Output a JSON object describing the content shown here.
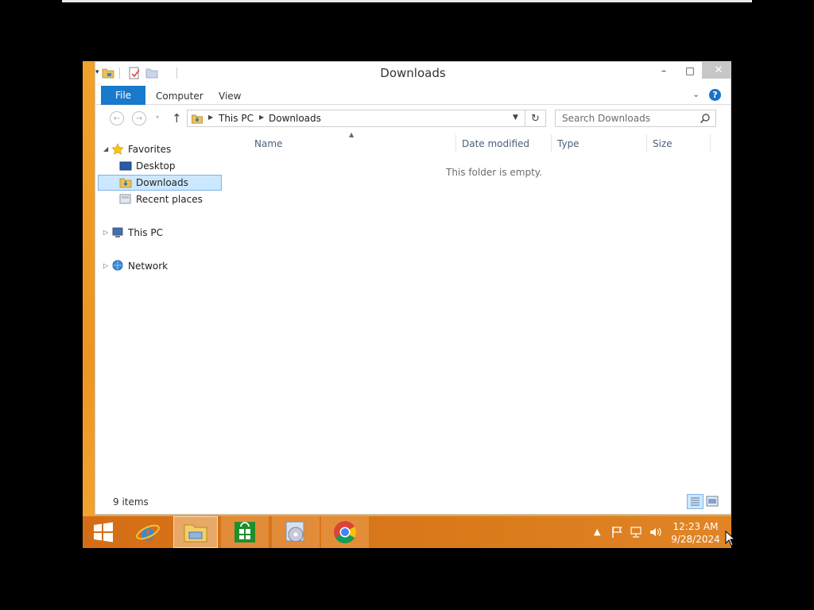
{
  "window": {
    "title": "Downloads",
    "controls": {
      "minimize": "–",
      "maximize": "□",
      "close": "✕"
    }
  },
  "ribbon": {
    "tabs": [
      {
        "label": "File",
        "active": true
      },
      {
        "label": "Computer"
      },
      {
        "label": "View"
      }
    ],
    "help": "?"
  },
  "navigation": {
    "breadcrumb": [
      "This PC",
      "Downloads"
    ],
    "search_placeholder": "Search Downloads"
  },
  "sidebar": {
    "items": [
      {
        "label": "Favorites",
        "icon": "star-icon",
        "expanded": true
      },
      {
        "label": "Desktop",
        "icon": "desktop-icon"
      },
      {
        "label": "Downloads",
        "icon": "downloads-folder-icon",
        "selected": true
      },
      {
        "label": "Recent places",
        "icon": "recent-places-icon"
      },
      {
        "label": "This PC",
        "icon": "computer-icon",
        "expanded": false
      },
      {
        "label": "Network",
        "icon": "network-icon",
        "expanded": false
      }
    ]
  },
  "content": {
    "columns": [
      "Name",
      "Date modified",
      "Type",
      "Size"
    ],
    "empty_message": "This folder is empty."
  },
  "status": {
    "item_count": "9 items"
  },
  "taskbar": {
    "apps": [
      {
        "name": "Start",
        "icon": "windows-start-icon"
      },
      {
        "name": "Internet Explorer",
        "icon": "internet-explorer-icon"
      },
      {
        "name": "File Explorer",
        "icon": "file-explorer-icon",
        "active": true
      },
      {
        "name": "Store",
        "icon": "store-icon"
      },
      {
        "name": "Setup",
        "icon": "setup-disc-icon"
      },
      {
        "name": "Chrome",
        "icon": "chrome-icon"
      }
    ],
    "clock": {
      "time": "12:23 AM",
      "date": "9/28/2024"
    }
  },
  "colors": {
    "accent": "#1979ca",
    "selection": "#cce8ff",
    "taskbar": "#d9771b",
    "desktop": "#ef9a27"
  }
}
